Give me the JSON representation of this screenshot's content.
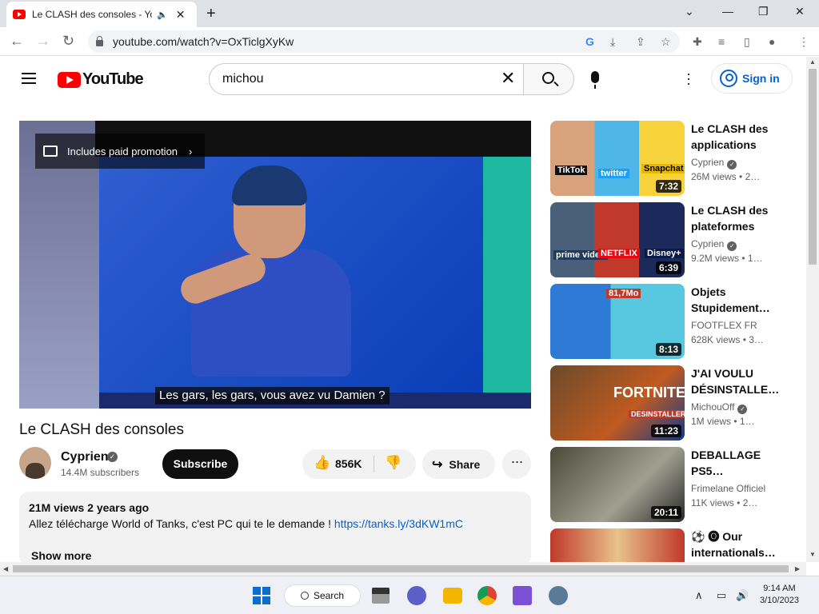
{
  "browser": {
    "tab_title": "Le CLASH des consoles - YouTube",
    "url": "youtube.com/watch?v=OxTiclgXyKw"
  },
  "youtube": {
    "search_value": "michou",
    "logo_text": "YouTube",
    "sign_in": "Sign in"
  },
  "player": {
    "paid_promotion": "Includes paid promotion",
    "subtitle": "Les gars, les gars, vous avez vu Damien ?"
  },
  "video": {
    "title": "Le CLASH des consoles",
    "channel": "Cyprien",
    "subscribers": "14.4M subscribers",
    "subscribe_label": "Subscribe",
    "likes": "856K",
    "share_label": "Share",
    "views_date": "21M views  2 years ago",
    "description": "Allez télécharge World of Tanks, c'est PC qui te le demande !",
    "description_link": "https://tanks.ly/3dKW1mC",
    "show_more": "Show more"
  },
  "recommendations": [
    {
      "title": "Le CLASH des applications",
      "channel": "Cyprien",
      "verified": true,
      "views": "26M views",
      "age": "• 2…",
      "duration": "7:32",
      "labels": [
        "TikTok",
        "twitter",
        "Snapchat"
      ]
    },
    {
      "title": "Le CLASH des plateformes",
      "channel": "Cyprien",
      "verified": true,
      "views": "9.2M views",
      "age": "• 1…",
      "duration": "6:39",
      "labels": [
        "prime video",
        "NETFLIX",
        "Disney+"
      ]
    },
    {
      "title": "Objets Stupidement…",
      "channel": "FOOTFLEX FR",
      "verified": false,
      "views": "628K views",
      "age": "• 3…",
      "duration": "8:13",
      "labels": [
        "81,7Mo"
      ]
    },
    {
      "title": "J'AI VOULU DÉSINSTALLE…",
      "channel": "MichouOff",
      "verified": true,
      "views": "1M views",
      "age": "• 1…",
      "duration": "11:23",
      "labels": [
        "FORTNITE",
        "DESINSTALLER"
      ]
    },
    {
      "title": "DEBALLAGE PS5…",
      "channel": "Frimelane Officiel",
      "verified": false,
      "views": "11K views",
      "age": "• 2…",
      "duration": "20:11",
      "labels": []
    },
    {
      "title": "⚽ 🅞 Our internationals…",
      "channel": "",
      "verified": false,
      "views": "",
      "age": "",
      "duration": "",
      "labels": []
    }
  ],
  "taskbar": {
    "search_label": "Search",
    "time": "9:14 AM",
    "date": "3/10/2023"
  }
}
